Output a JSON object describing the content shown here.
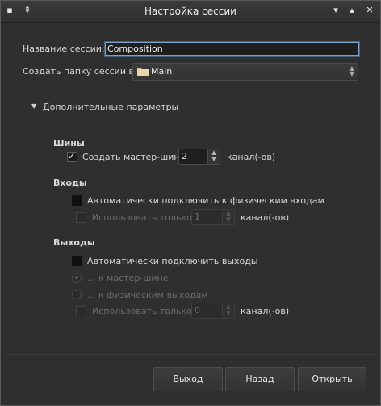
{
  "window": {
    "title": "Настройка сессии"
  },
  "session_name": {
    "label": "Название сессии:",
    "value": "Composition"
  },
  "folder": {
    "label": "Создать папку сессии в:",
    "value": "Main"
  },
  "advanced": {
    "label": "Дополнительные параметры"
  },
  "busses": {
    "heading": "Шины",
    "create_master_label": "Создать мастер-шину",
    "create_master_checked": true,
    "channels_value": "2",
    "channels_unit": "канал(-ов)"
  },
  "inputs": {
    "heading": "Входы",
    "auto_connect_label": "Автоматически подключить к физическим входам",
    "use_only_label": "Использовать только",
    "use_only_value": "1",
    "unit": "канал(-ов)"
  },
  "outputs": {
    "heading": "Выходы",
    "auto_connect_label": "Автоматически подключить выходы",
    "radio_master_label": "... к мастер-шине",
    "radio_physical_label": "... к физическим выходам",
    "use_only_label": "Использовать только",
    "use_only_value": "0",
    "unit": "канал(-ов)"
  },
  "buttons": {
    "quit": "Выход",
    "back": "Назад",
    "open": "Открыть"
  },
  "colors": {
    "background": "#2f2f2f",
    "focus": "#7fa3c7"
  }
}
